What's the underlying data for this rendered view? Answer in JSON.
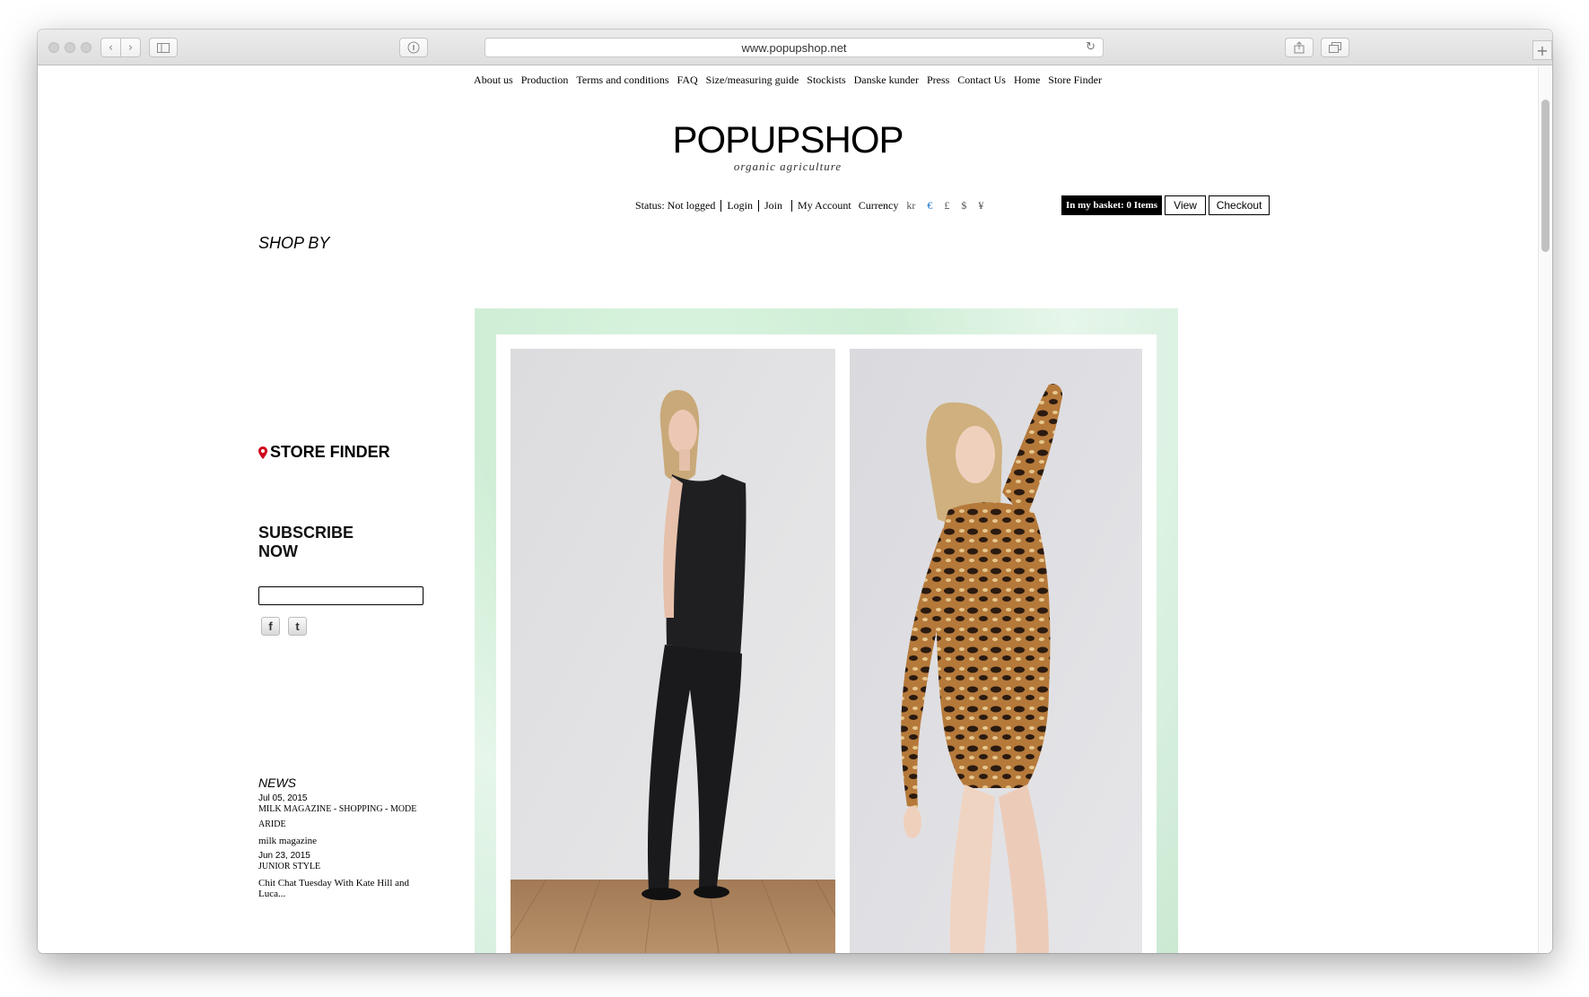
{
  "browser": {
    "url": "www.popupshop.net"
  },
  "topnav": {
    "items": [
      "About us",
      "Production",
      "Terms and conditions",
      "FAQ",
      "Size/measuring guide",
      "Stockists",
      "Danske kunder",
      "Press",
      "Contact Us",
      "Home",
      "Store Finder"
    ]
  },
  "logo": {
    "name": "POPUPSHOP",
    "tagline": "organic agriculture"
  },
  "account": {
    "status": "Status: Not logged",
    "login": "Login",
    "join": "Join",
    "my_account": "My Account",
    "currency_label": "Currency",
    "currencies": [
      "kr",
      "€",
      "£",
      "$",
      "¥"
    ],
    "active_currency": "€"
  },
  "basket": {
    "label": "In my basket: 0 Items",
    "view": "View",
    "checkout": "Checkout"
  },
  "sidebar": {
    "shop_by": "SHOP BY",
    "store_finder": "STORE FINDER",
    "subscribe_line1": "SUBSCRIBE",
    "subscribe_line2": "NOW",
    "subscribe_value": "",
    "facebook_icon": "facebook-icon",
    "twitter_icon": "twitter-icon"
  },
  "news": {
    "title": "NEWS",
    "items": [
      {
        "date": "Jul 05, 2015",
        "category": "MILK MAGAZINE - SHOPPING - MODE",
        "tag": "ARIDE",
        "headline": "milk magazine"
      },
      {
        "date": "Jun 23, 2015",
        "category": "JUNIOR STYLE",
        "headline": "Chit Chat Tuesday With Kate Hill and Luca..."
      }
    ]
  },
  "colors": {
    "accent_blue": "#1a73c8",
    "pin_red": "#d0021b",
    "hero_green": "#d6efde"
  }
}
